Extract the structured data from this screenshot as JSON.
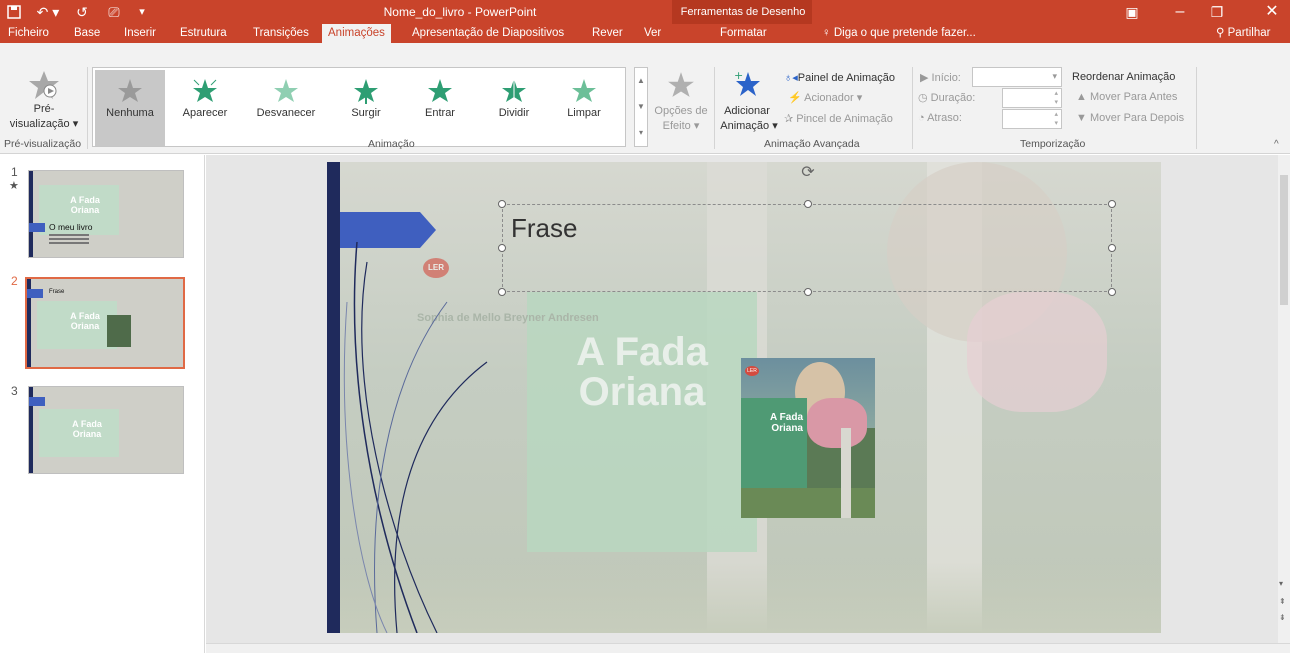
{
  "titlebar": {
    "doc_title": "Nome_do_livro - PowerPoint",
    "context_label": "Ferramentas de Desenho"
  },
  "tabs": {
    "ficheiro": "Ficheiro",
    "base": "Base",
    "inserir": "Inserir",
    "estrutura": "Estrutura",
    "transicoes": "Transições",
    "animacoes": "Animações",
    "apresentacao": "Apresentação de Diapositivos",
    "rever": "Rever",
    "ver": "Ver",
    "formatar": "Formatar",
    "tell_me": "Diga o que pretende fazer...",
    "share": "Partilhar"
  },
  "ribbon": {
    "preview_line1": "Pré-",
    "preview_line2": "visualização",
    "group_preview": "Pré-visualização",
    "effects": [
      {
        "label": "Nenhuma"
      },
      {
        "label": "Aparecer"
      },
      {
        "label": "Desvanecer"
      },
      {
        "label": "Surgir"
      },
      {
        "label": "Entrar"
      },
      {
        "label": "Dividir"
      },
      {
        "label": "Limpar"
      }
    ],
    "effect_options_line1": "Opções de",
    "effect_options_line2": "Efeito",
    "group_animation": "Animação",
    "add_anim_line1": "Adicionar",
    "add_anim_line2": "Animação",
    "anim_pane": "Painel de Animação",
    "trigger": "Acionador",
    "anim_painter": "Pincel de Animação",
    "group_advanced": "Animação Avançada",
    "start_label": "Início:",
    "duration_label": "Duração:",
    "delay_label": "Atraso:",
    "reorder": "Reordenar Animação",
    "move_earlier": "Mover Para Antes",
    "move_later": "Mover Para Depois",
    "group_timing": "Temporização"
  },
  "thumbnails": [
    {
      "num": "1",
      "title": "A Fada Oriana",
      "caption": "O meu livro"
    },
    {
      "num": "2",
      "title": "A Fada Oriana",
      "caption": "Frase"
    },
    {
      "num": "3",
      "title": "A Fada Oriana",
      "caption": ""
    }
  ],
  "slide": {
    "placeholder_text": "Frase",
    "bg_title_line1": "A Fada",
    "bg_title_line2": "Oriana",
    "bg_author": "Sophia de Mello Breyner Andresen",
    "bg_logo": "LER",
    "cover_title_line1": "A Fada",
    "cover_title_line2": "Oriana",
    "cover_logo": "LER"
  },
  "colors": {
    "accent": "#c9442b",
    "selected_thumb": "#e06945",
    "slide_ribbon": "#3f5fbf",
    "slide_band": "#1f2a5c"
  }
}
